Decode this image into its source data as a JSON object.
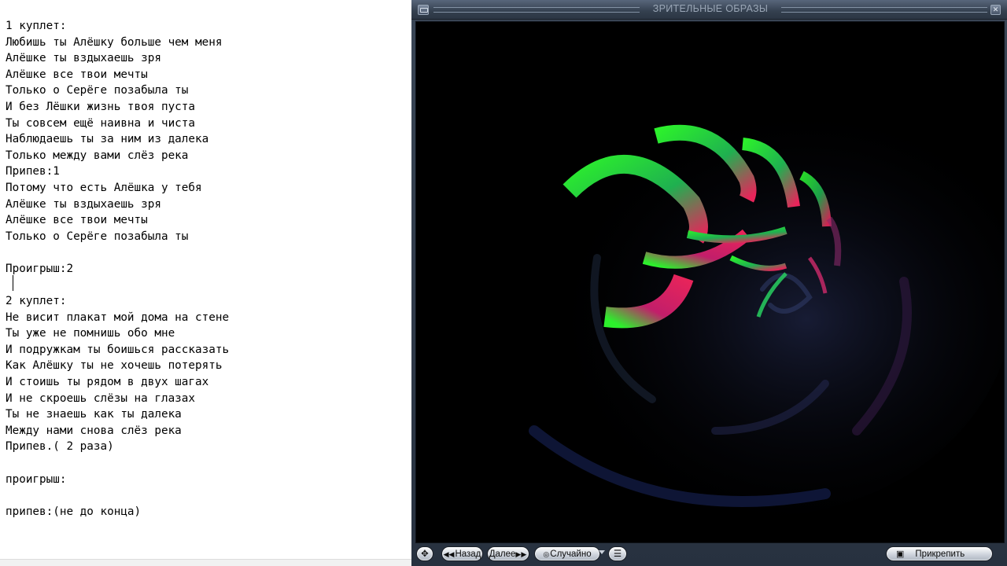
{
  "editor": {
    "lines": [
      "1 куплет:",
      "Любишь ты Алёшку больше чем меня",
      "Алёшке ты вздыхаешь зря",
      "Алёшке все твои мечты",
      "Только о Серёге позабыла ты",
      "И без Лёшки жизнь твоя пуста",
      "Ты совсем ещё наивна и чиста",
      "Наблюдаешь ты за ним из далека",
      "Только между вами слёз река",
      "Припев:1",
      "Потому что есть Алёшка у тебя",
      "Алёшке ты вздыхаешь зря",
      "Алёшке все твои мечты",
      "Только о Серёге позабыла ты",
      "",
      "Проигрыш:2",
      "",
      "2 куплет:",
      "Не висит плакат мой дома на стене",
      "Ты уже не помнишь обо мне",
      "И подружкам ты боишься рассказать",
      "Как Алёшку ты не хочешь потерять",
      "И стоишь ты рядом в двух шагах",
      "И не скроешь слёзы на глазах",
      "Ты не знаешь как ты далека",
      "Между нами снова слёз река",
      "Припев.( 2 раза)",
      "",
      "проигрыш:",
      "",
      "припев:(не до конца)"
    ]
  },
  "player": {
    "title": "ЗРИТЕЛЬНЫЕ ОБРАЗЫ",
    "icons": {
      "title_menu": "window-menu-icon",
      "title_close": "close-icon",
      "move": "move-cross-icon",
      "back": "rewind-icon",
      "next": "fast-forward-icon",
      "random": "random-icon",
      "menu": "list-menu-icon",
      "pin": "pin-icon"
    },
    "controls": {
      "back_label": "Назад",
      "next_label": "Далее",
      "random_label": "Случайно",
      "pin_label": "Прикрепить"
    },
    "colors": {
      "accent_green": "#2cf02c",
      "accent_red": "#e8245a",
      "viz_background": "#000000"
    }
  }
}
